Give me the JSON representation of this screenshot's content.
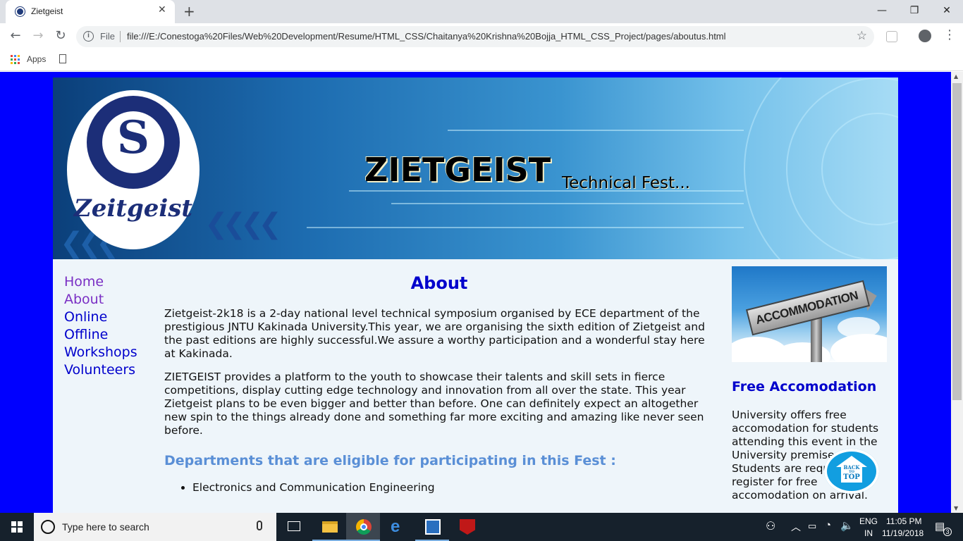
{
  "browser": {
    "tab_title": "Zietgeist",
    "tab_close": "✕",
    "new_tab": "+",
    "window_controls": {
      "minimize": "—",
      "maximize": "❐",
      "close": "✕"
    },
    "nav": {
      "back": "←",
      "forward": "→",
      "reload": "↻"
    },
    "address": {
      "info": "i",
      "scheme": "File",
      "url": "file:///E:/Conestoga%20Files/Web%20Development/Resume/HTML_CSS/Chaitanya%20Krishna%20Bojja_HTML_CSS_Project/pages/aboutus.html",
      "star": "☆"
    },
    "menu": "⋮",
    "bookmarks": {
      "apps_label": "Apps"
    }
  },
  "page": {
    "banner": {
      "logo_word": "Zeitgeist",
      "logo_mark": "S",
      "title": "ZIETGEIST",
      "tagline": "Technical Fest..."
    },
    "nav": [
      {
        "label": "Home"
      },
      {
        "label": "About"
      },
      {
        "label": "Online"
      },
      {
        "label": "Offline"
      },
      {
        "label": "Workshops"
      },
      {
        "label": "Volunteers"
      }
    ],
    "main": {
      "heading": "About",
      "para1": "Zietgeist-2k18 is a 2-day national level technical symposium organised by ECE department of the prestigious JNTU Kakinada University.This year, we are organising the sixth edition of Zietgeist and the past editions are highly successful.We assure a worthy participation and a wonderful stay here at Kakinada.",
      "para2": "ZIETGEIST provides a platform to the youth to showcase their talents and skill sets in fierce competitions, display cutting edge technology and innovation from all over the state. This year Zietgeist plans to be even bigger and better than before. One can definitely expect an altogether new spin to the things already done and something far more exciting and amazing like never seen before.",
      "departments_heading": "Departments that are eligible for participating in this Fest :",
      "departments": [
        "Electronics and Communication Engineering"
      ]
    },
    "aside": {
      "image_sign_text": "ACCOMMODATION",
      "heading": "Free Accomodation",
      "text": "University offers free accomodation for students attending this event in the University premises. Students are requested to register for free accomodation on arrival."
    },
    "back_to_top": {
      "line1": "BACK",
      "line2": "TO",
      "line3": "TOP"
    }
  },
  "taskbar": {
    "search_placeholder": "Type here to search",
    "lang1": "ENG",
    "lang2": "IN",
    "time": "11:05 PM",
    "date": "11/19/2018",
    "notifications": "3"
  },
  "colors": {
    "page_background": "#0000ff",
    "nav_link": "#0000cc",
    "nav_visited": "#7a2fc4",
    "subheading": "#5a8fd6",
    "content_background": "#eef5fa"
  }
}
